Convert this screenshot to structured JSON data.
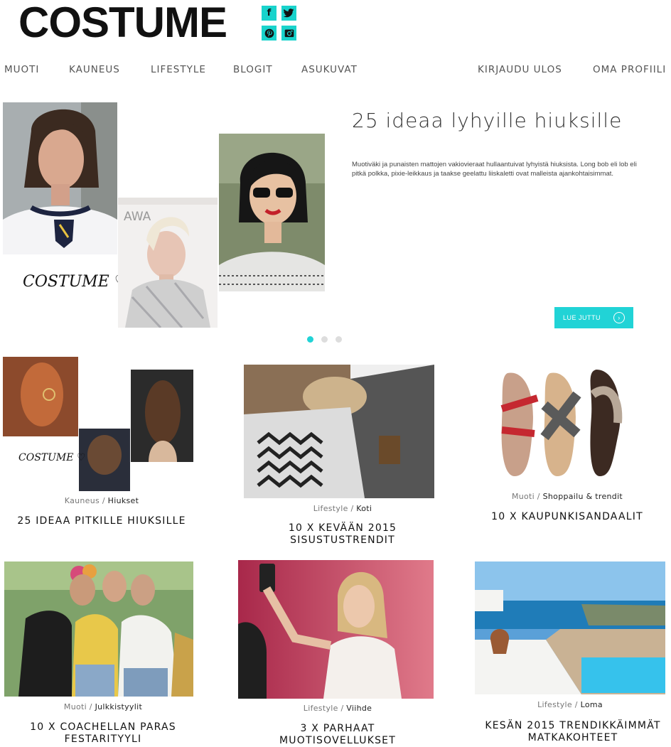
{
  "header": {
    "logo": "COSTUME",
    "social": [
      {
        "name": "facebook-icon",
        "glyph": "f"
      },
      {
        "name": "twitter-icon",
        "glyph": "t"
      },
      {
        "name": "pinterest-icon",
        "glyph": "p"
      },
      {
        "name": "instagram-icon",
        "glyph": "◙"
      }
    ],
    "accent": "#19d3cc"
  },
  "nav": {
    "left": [
      "MUOTI",
      "KAUNEUS",
      "LIFESTYLE",
      "BLOGIT",
      "ASUKUVAT"
    ],
    "right": [
      "KIRJAUDU ULOS",
      "OMA PROFIILI"
    ]
  },
  "hero": {
    "title": "25 ideaa lyhyille hiuksille",
    "text": "Muotiväki ja punaisten mattojen vakiovieraat hullaantuivat lyhyistä hiuksista. Long bob eli lob eli pitkä polkka, pixie-leikkaus ja taakse geelattu liiskaletti ovat malleista ajankohtaisimmat.",
    "signature": "COSTUME ♡",
    "photo_sign": "AWA",
    "button": "LUE JUTTU",
    "active_slide": 1,
    "slides": 3
  },
  "cards": [
    {
      "category": "Kauneus",
      "subcategory": "Hiukset",
      "title": "25 IDEAA PITKILLE HIUKSILLE",
      "signature": "COSTUME ♡"
    },
    {
      "category": "Lifestyle",
      "subcategory": "Koti",
      "title": "10 X KEVÄÄN 2015 SISUSTUSTRENDIT"
    },
    {
      "category": "Muoti",
      "subcategory": "Shoppailu & trendit",
      "title": "10 X KAUPUNKISANDAALIT"
    },
    {
      "category": "Muoti",
      "subcategory": "Julkkistyylit",
      "title": "10 X COACHELLAN PARAS FESTARITYYLI"
    },
    {
      "category": "Lifestyle",
      "subcategory": "Viihde",
      "title": "3 X PARHAAT MUOTISOVELLUKSET"
    },
    {
      "category": "Lifestyle",
      "subcategory": "Loma",
      "title": "KESÄN 2015 TRENDIKKÄIMMÄT MATKAKOHTEET"
    }
  ]
}
